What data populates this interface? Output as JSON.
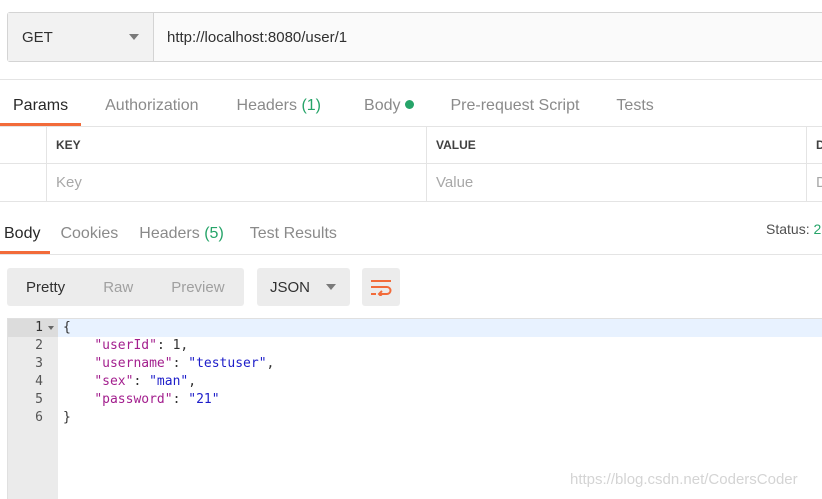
{
  "request": {
    "method": "GET",
    "url": "http://localhost:8080/user/1"
  },
  "request_tabs": [
    {
      "label": "Params",
      "active": true
    },
    {
      "label": "Authorization"
    },
    {
      "label": "Headers",
      "count": "(1)"
    },
    {
      "label": "Body"
    },
    {
      "label": "Pre-request Script"
    },
    {
      "label": "Tests"
    }
  ],
  "params_table": {
    "columns": [
      "KEY",
      "VALUE",
      "D"
    ],
    "placeholders": [
      "Key",
      "Value",
      "D"
    ]
  },
  "response_tabs": [
    {
      "label": "Body",
      "active": true
    },
    {
      "label": "Cookies"
    },
    {
      "label": "Headers",
      "count": "(5)"
    },
    {
      "label": "Test Results"
    }
  ],
  "status": {
    "label": "Status:",
    "value": "2"
  },
  "view_modes": [
    "Pretty",
    "Raw",
    "Preview"
  ],
  "format": "JSON",
  "code_lines": [
    {
      "num": "1",
      "tokens": [
        {
          "t": "{",
          "c": "n"
        }
      ]
    },
    {
      "num": "2",
      "tokens": [
        {
          "t": "    ",
          "c": "n"
        },
        {
          "t": "\"userId\"",
          "c": "k"
        },
        {
          "t": ": 1,",
          "c": "n"
        }
      ]
    },
    {
      "num": "3",
      "tokens": [
        {
          "t": "    ",
          "c": "n"
        },
        {
          "t": "\"username\"",
          "c": "k"
        },
        {
          "t": ": ",
          "c": "n"
        },
        {
          "t": "\"testuser\"",
          "c": "s"
        },
        {
          "t": ",",
          "c": "n"
        }
      ]
    },
    {
      "num": "4",
      "tokens": [
        {
          "t": "    ",
          "c": "n"
        },
        {
          "t": "\"sex\"",
          "c": "k"
        },
        {
          "t": ": ",
          "c": "n"
        },
        {
          "t": "\"man\"",
          "c": "s"
        },
        {
          "t": ",",
          "c": "n"
        }
      ]
    },
    {
      "num": "5",
      "tokens": [
        {
          "t": "    ",
          "c": "n"
        },
        {
          "t": "\"password\"",
          "c": "k"
        },
        {
          "t": ": ",
          "c": "n"
        },
        {
          "t": "\"21\"",
          "c": "s"
        }
      ]
    },
    {
      "num": "6",
      "tokens": [
        {
          "t": "}",
          "c": "n"
        }
      ]
    }
  ],
  "watermark": "https://blog.csdn.net/CodersCoder",
  "colors": {
    "accent": "#f26b3a",
    "success": "#26a469",
    "json_key": "#a31f8e",
    "json_string": "#1d1dc9"
  }
}
